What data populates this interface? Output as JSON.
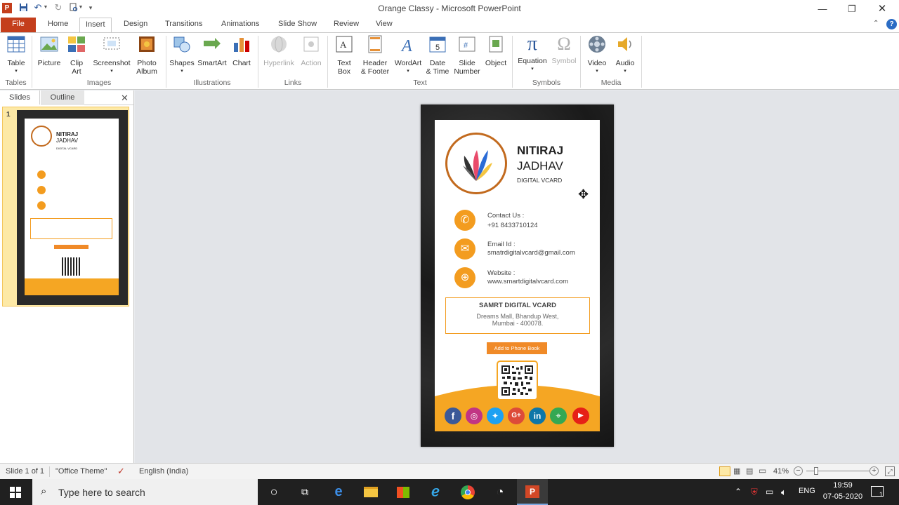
{
  "window": {
    "title": "Orange Classy - Microsoft PowerPoint"
  },
  "tabs": {
    "file": "File",
    "home": "Home",
    "insert": "Insert",
    "design": "Design",
    "transitions": "Transitions",
    "animations": "Animations",
    "slideshow": "Slide Show",
    "review": "Review",
    "view": "View"
  },
  "ribbon": {
    "table": "Table",
    "picture": "Picture",
    "clipart_1": "Clip",
    "clipart_2": "Art",
    "screenshot": "Screenshot",
    "photoalbum_1": "Photo",
    "photoalbum_2": "Album",
    "shapes": "Shapes",
    "smartart": "SmartArt",
    "chart": "Chart",
    "hyperlink": "Hyperlink",
    "action": "Action",
    "textbox_1": "Text",
    "textbox_2": "Box",
    "header_1": "Header",
    "header_2": "& Footer",
    "wordart": "WordArt",
    "datetime_1": "Date",
    "datetime_2": "& Time",
    "slidenum_1": "Slide",
    "slidenum_2": "Number",
    "object": "Object",
    "equation": "Equation",
    "symbol": "Symbol",
    "video": "Video",
    "audio": "Audio",
    "groups": {
      "tables": "Tables",
      "images": "Images",
      "illustrations": "Illustrations",
      "links": "Links",
      "text": "Text",
      "symbols": "Symbols",
      "media": "Media"
    }
  },
  "pane": {
    "slides_tab": "Slides",
    "outline_tab": "Outline",
    "slide_number": "1"
  },
  "card": {
    "name_1": "NITIRAJ",
    "name_2": "JADHAV",
    "subtitle": "DIGITAL VCARD",
    "contact_label": "Contact Us :",
    "contact_value": "+91 8433710124",
    "email_label": "Email Id :",
    "email_value": "smatrdigitalvcard@gmail.com",
    "website_label": "Website :",
    "website_value": "www.smartdigitalvcard.com",
    "box_title": "SAMRT DIGITAL VCARD",
    "address_1": "Dreams Mall, Bhandup West,",
    "address_2": "Mumbai - 400078.",
    "button": "Add to Phone Book"
  },
  "status": {
    "slide": "Slide 1 of 1",
    "theme": "\"Office Theme\"",
    "language": "English (India)",
    "zoom": "41%"
  },
  "taskbar": {
    "search_placeholder": "Type here to search",
    "lang": "ENG",
    "time": "19:59",
    "date": "07-05-2020",
    "notif_count": "1"
  },
  "colors": {
    "accent": "#f39c1f",
    "file_tab": "#c43e1c",
    "card_orange": "#f5a623"
  }
}
